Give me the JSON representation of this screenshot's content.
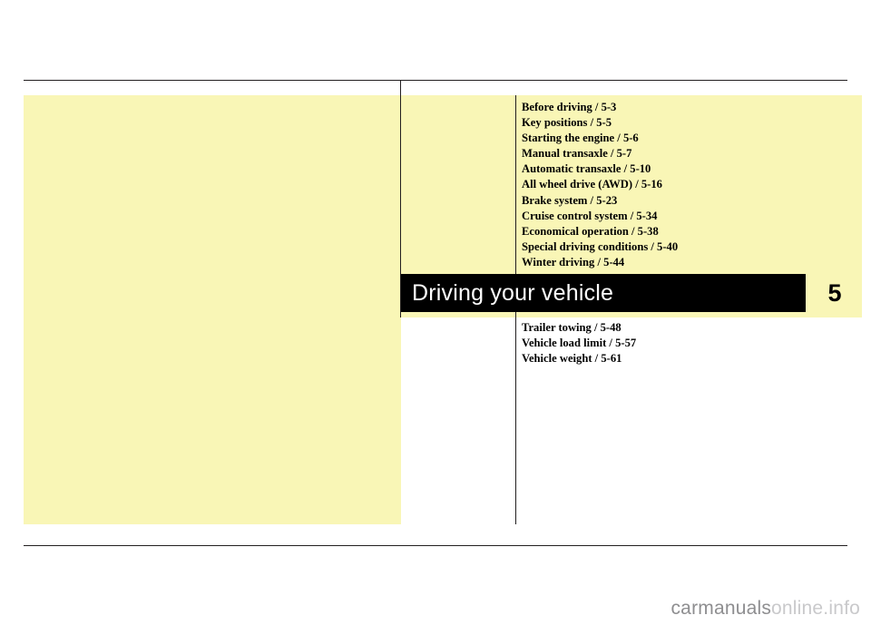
{
  "document": {
    "chapter_title": "Driving your vehicle",
    "chapter_number": "5"
  },
  "toc_top": [
    "Before driving / 5-3",
    "Key positions / 5-5",
    "Starting the engine / 5-6",
    "Manual transaxle / 5-7",
    "Automatic transaxle / 5-10",
    "All wheel drive (AWD) / 5-16",
    "Brake system / 5-23",
    "Cruise control system / 5-34",
    "Economical operation / 5-38",
    "Special driving conditions / 5-40",
    "Winter driving / 5-44"
  ],
  "toc_bottom": [
    "Trailer towing / 5-48",
    "Vehicle load limit / 5-57",
    "Vehicle weight / 5-61"
  ],
  "watermark": {
    "text_main": "carmanuals",
    "text_accent": "online.info"
  },
  "colors": {
    "panel": "#f9f6b6",
    "rule": "#231f20",
    "title_bar": "#000000",
    "title_text": "#ffffff"
  }
}
